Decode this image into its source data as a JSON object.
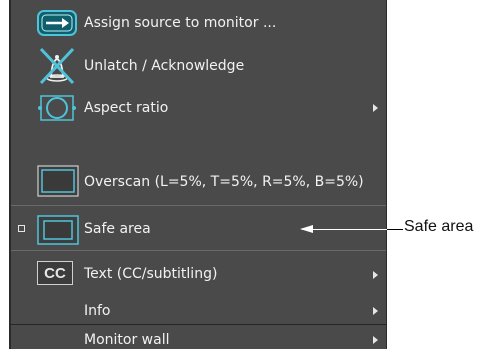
{
  "menu": {
    "items": [
      {
        "label": "Assign source to monitor ...",
        "icon": "assign-source-icon",
        "submenu": false
      },
      {
        "label": "Unlatch / Acknowledge",
        "icon": "unlatch-acknowledge-icon",
        "submenu": false
      },
      {
        "label": "Aspect ratio",
        "icon": "aspect-ratio-icon",
        "submenu": true
      },
      {
        "label": "Overscan (L=5%, T=5%, R=5%, B=5%)",
        "icon": "overscan-icon",
        "submenu": false
      },
      {
        "label": "Safe area",
        "icon": "safe-area-icon",
        "submenu": false,
        "checkbox": true
      },
      {
        "label": "Text (CC/subtitling)",
        "icon": "cc-icon",
        "icon_text": "CC",
        "submenu": true
      },
      {
        "label": "Info",
        "submenu": true
      },
      {
        "label": "Monitor wall",
        "submenu": true
      }
    ]
  },
  "callout": {
    "label": "Safe area"
  },
  "colors": {
    "menu_bg": "#4a4a4a",
    "icon_cyan": "#4fc3d9",
    "text": "#f2f2f2"
  }
}
